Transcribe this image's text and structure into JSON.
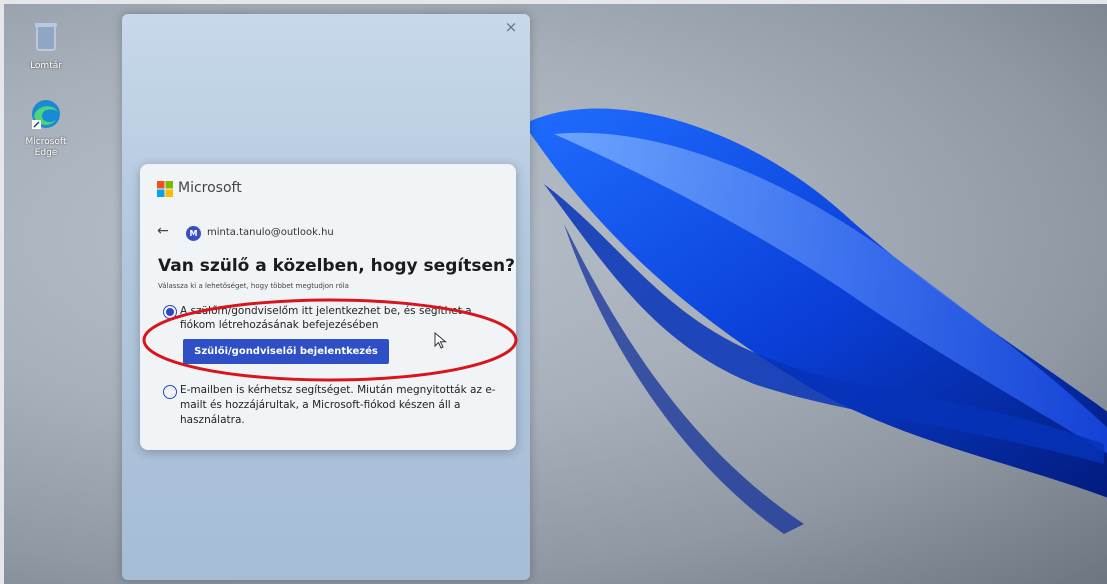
{
  "desktop": {
    "icons": [
      {
        "label": "Lomtár",
        "icon": "recycle-bin-icon"
      },
      {
        "label": "Microsoft Edge",
        "icon": "edge-icon"
      }
    ]
  },
  "window": {
    "close_glyph": "×"
  },
  "dialog": {
    "brand": "Microsoft",
    "account": {
      "avatar_letter": "M",
      "email": "minta.tanulo@outlook.hu"
    },
    "heading": "Van szülő a közelben, hogy segítsen?",
    "subheading": "Válassza ki a lehetőséget, hogy többet megtudjon róla",
    "options": [
      {
        "text": "A szülőm/gondviselőm itt jelentkezhet be, és segíthet a fiókom létrehozásának befejezésében",
        "selected": true,
        "button_label": "Szülői/gondviselői bejelentkezés"
      },
      {
        "text": "E-mailben is kérhetsz segítséget. Miután megnyitották az e-mailt és hozzájárultak, a Microsoft-fiókod készen áll a használatra.",
        "selected": false
      }
    ]
  },
  "annotation": {
    "color": "#d9141c"
  },
  "colors": {
    "accent": "#2f4fc7",
    "annotation": "#d9141c",
    "wallpaper": "#0a3fd8"
  }
}
